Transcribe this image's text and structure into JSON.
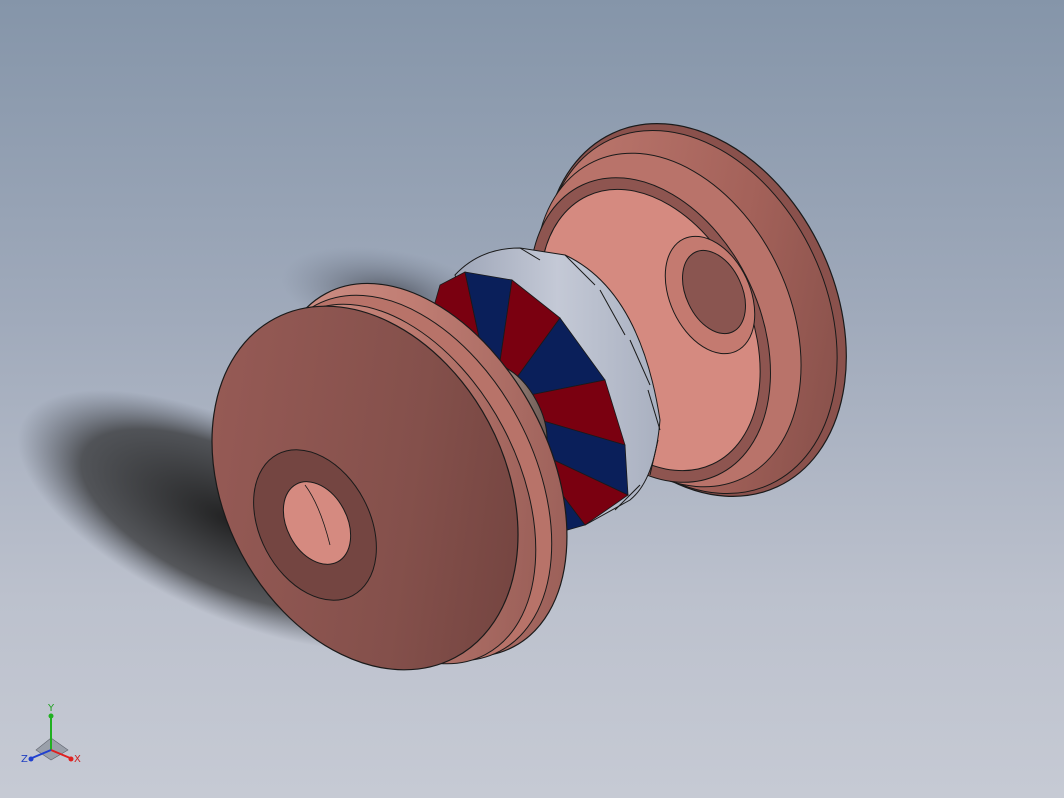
{
  "view": {
    "background_top": "#8595a9",
    "background_bottom": "#c6cad4",
    "part_color": "#a8625c",
    "magnet_red": "#7a0010",
    "magnet_blue": "#0a1f5a",
    "band_color": "#b4bac9"
  },
  "triad": {
    "x_label": "X",
    "y_label": "Y",
    "z_label": "Z",
    "x_color": "#e02020",
    "y_color": "#20b020",
    "z_color": "#2040d0"
  }
}
